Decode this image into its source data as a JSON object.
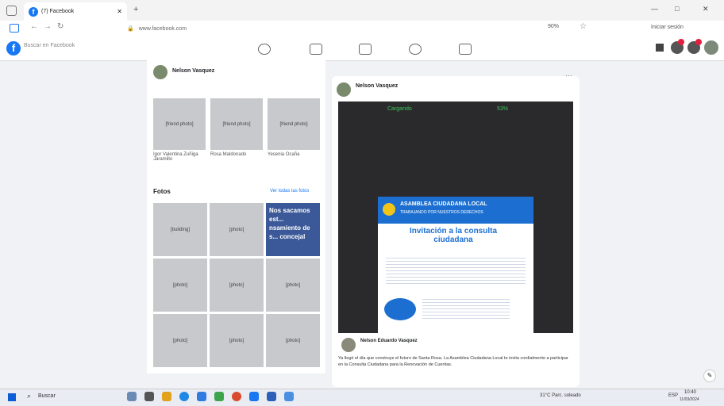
{
  "browser": {
    "tab_title": "(7) Facebook",
    "tab_add": "+",
    "url": "www.facebook.com",
    "window_controls": [
      "—",
      "□",
      "✕"
    ],
    "profile_label": "Iniciar sesión",
    "zoom": "90%"
  },
  "facebook": {
    "logo_letter": "f",
    "search_placeholder": "Buscar en Facebook"
  },
  "profile": {
    "name": "Nelson Vasquez"
  },
  "friends": [
    {
      "name": "Igor Valentina Zuñiga Jaramillo"
    },
    {
      "name": "Rosa Maldonado"
    },
    {
      "name": "Yesenia Ocaña"
    }
  ],
  "photos_section": {
    "title": "Fotos",
    "see_all": "Ver todas las fotos",
    "overlay_text": "Nos sacamos est... nsamiento de s... concejal"
  },
  "post": {
    "author": "Nelson Vasquez",
    "more": "···",
    "video_overlay_left": "Cargando",
    "video_overlay_right": "53%",
    "flyer_title": "ASAMBLEA CIUDADANA LOCAL",
    "flyer_subtitle": "TRABAJANDO POR NUESTROS DERECHOS",
    "flyer_heading": "Invitación a la consulta ciudadana",
    "shared_author": "Nelson Eduardo Vasquez",
    "caption": "Ya llegó el día que construye el futuro de Santa Rosa. La Asamblea Ciudadana Local te invita cordialmente a participar en la Consulta Ciudadana para la Renovación de Cuentas."
  },
  "taskbar": {
    "search_label": "Buscar",
    "weather": "31°C Parc. soleado",
    "time": "10:40",
    "date": "11/03/2024",
    "lang": "ESP"
  },
  "colors": {
    "facebook_blue": "#1877f2",
    "flyer_blue": "#1c6fd1",
    "video_bg": "#2a2a2c"
  }
}
